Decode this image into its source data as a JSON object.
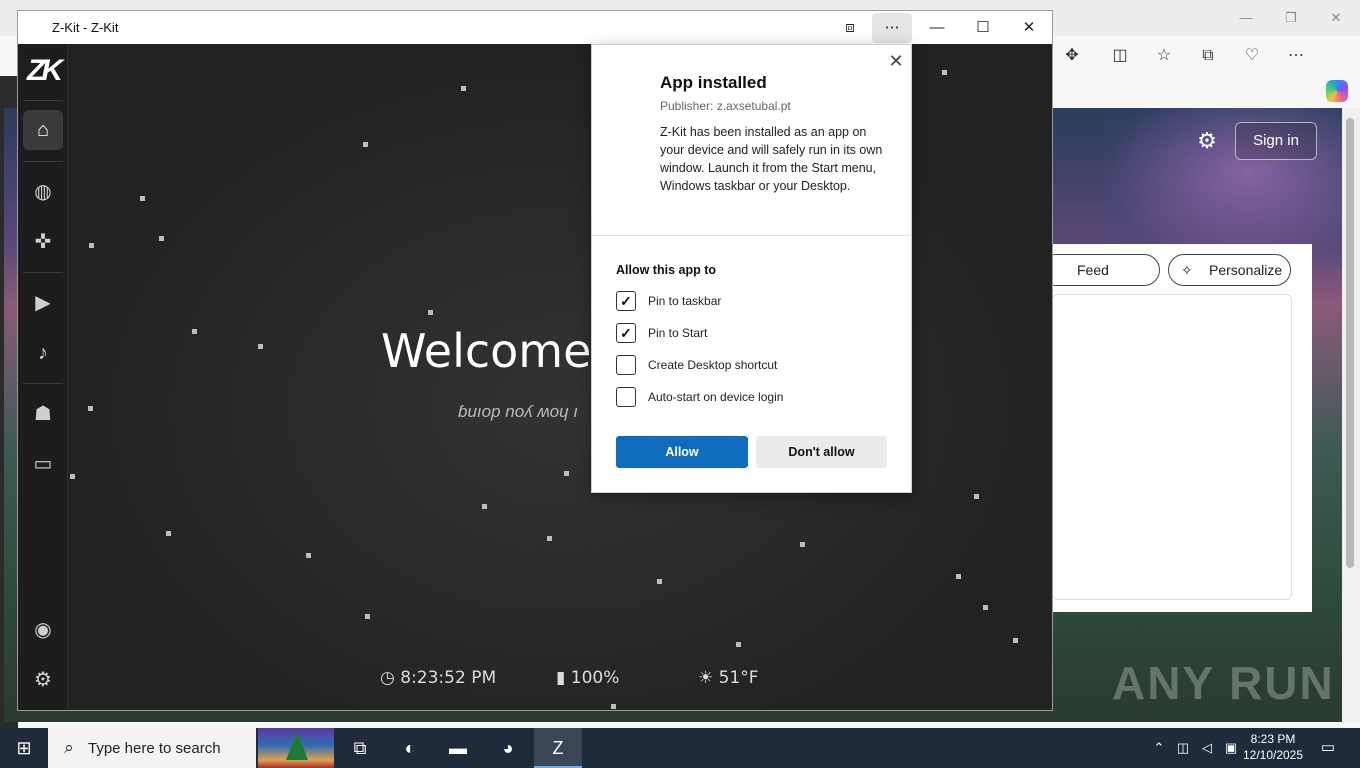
{
  "browser": {
    "toolbar_icons": [
      "extensions-icon",
      "split-screen-icon",
      "favorites-icon",
      "collections-icon",
      "browser-essentials-icon",
      "more-icon",
      "copilot-icon"
    ],
    "sign_in_label": "Sign in",
    "feed_layout_label": "Feed layout",
    "personalize_label": "Personalize",
    "watermark": "ANY RUN"
  },
  "app_window": {
    "title": "Z-Kit - Z-Kit",
    "logo_text": "ZK",
    "sidebar_items": [
      {
        "icon": "home-icon",
        "glyph": "⌂"
      },
      {
        "icon": "globe-icon",
        "glyph": "◍"
      },
      {
        "icon": "gamepad-icon",
        "glyph": "✜"
      },
      {
        "icon": "video-icon",
        "glyph": "▶"
      },
      {
        "icon": "music-icon",
        "glyph": "♪"
      },
      {
        "icon": "robot-icon",
        "glyph": "☗"
      },
      {
        "icon": "chat-icon",
        "glyph": "▭"
      }
    ],
    "sidebar_bottom": [
      {
        "icon": "discord-icon",
        "glyph": "◉"
      },
      {
        "icon": "settings-icon",
        "glyph": "⚙"
      }
    ],
    "welcome_text": "Welcome t",
    "subtitle_text": "ɓuıop noʎ ʍoɥ ı",
    "status": {
      "time": "8:23:52 PM",
      "battery": "100%",
      "weather": "51°F"
    }
  },
  "dialog": {
    "title": "App installed",
    "publisher": "Publisher: z.axsetubal.pt",
    "description": "Z-Kit has been installed as an app on your device and will safely run in its own window. Launch it from the Start menu, Windows taskbar or your Desktop.",
    "allow_label": "Allow this app to",
    "options": [
      {
        "label": "Pin to taskbar",
        "checked": true
      },
      {
        "label": "Pin to Start",
        "checked": true
      },
      {
        "label": "Create Desktop shortcut",
        "checked": false
      },
      {
        "label": "Auto-start on device login",
        "checked": false
      }
    ],
    "allow_button": "Allow",
    "deny_button": "Don't allow"
  },
  "taskbar": {
    "search_placeholder": "Type here to search",
    "time": "8:23 PM",
    "date": "12/10/2025"
  }
}
